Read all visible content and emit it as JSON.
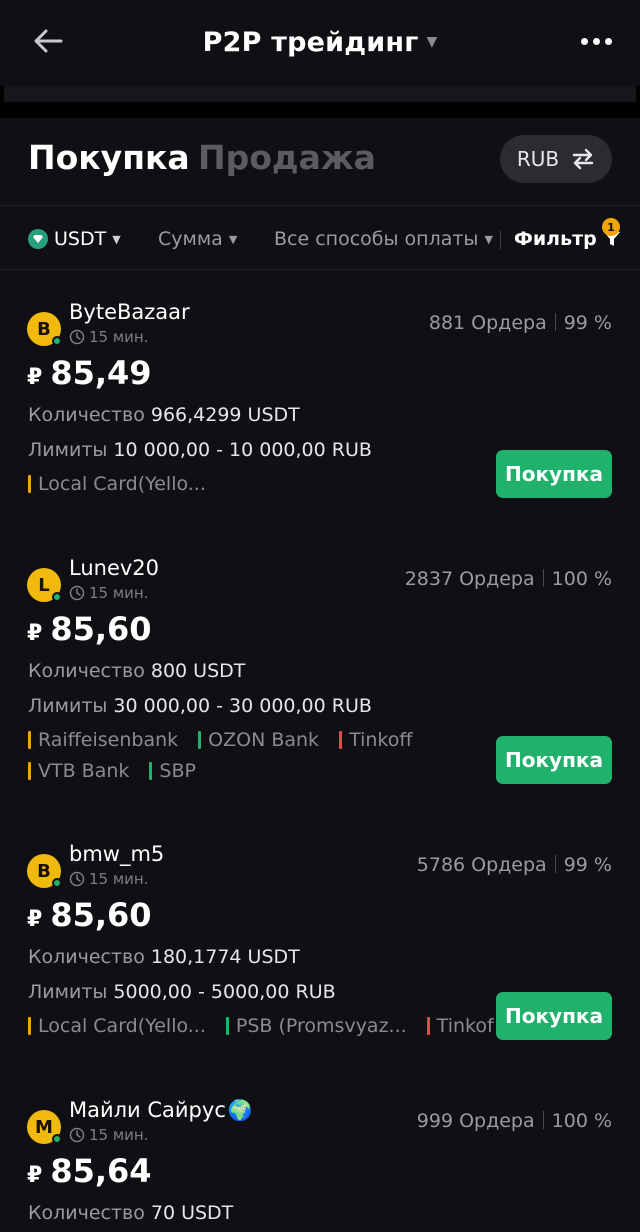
{
  "header": {
    "title": "P2P трейдинг",
    "back_icon": "arrow-left-icon",
    "more_icon": "more-dots-icon"
  },
  "tabs": {
    "buy": "Покупка",
    "sell": "Продажа",
    "currency": "RUB"
  },
  "filters": {
    "coin": "USDT",
    "amount": "Сумма",
    "payment": "Все способы оплаты",
    "filter": "Фильтр",
    "filter_count": "1"
  },
  "labels": {
    "quantity": "Количество",
    "limits": "Лимиты",
    "buy_button": "Покупка",
    "currency_symbol": "₽"
  },
  "colors": {
    "accent_green": "#20b26c",
    "avatar": "#f0b90b",
    "usdt": "#26a17b"
  },
  "offers": [
    {
      "avatar": "B",
      "name": "ByteBazaar",
      "emoji": "",
      "time": "15 мин.",
      "orders": "881 Ордера",
      "rate": "99 %",
      "price": "85,49",
      "quantity": "966,4299 USDT",
      "limits": "10 000,00 - 10 000,00 RUB",
      "payments": [
        [
          {
            "name": "Local Card(Yello...",
            "color": "#f0a500"
          }
        ]
      ]
    },
    {
      "avatar": "L",
      "name": "Lunev20",
      "emoji": "",
      "time": "15 мин.",
      "orders": "2837 Ордера",
      "rate": "100 %",
      "price": "85,60",
      "quantity": "800 USDT",
      "limits": "30 000,00 - 30 000,00 RUB",
      "payments": [
        [
          {
            "name": "Raiffeisenbank",
            "color": "#f0a500"
          },
          {
            "name": "OZON Bank",
            "color": "#20b26c"
          },
          {
            "name": "Tinkoff",
            "color": "#e5484d"
          }
        ],
        [
          {
            "name": "VTB Bank",
            "color": "#f0a500"
          },
          {
            "name": "SBP",
            "color": "#20b26c"
          }
        ]
      ]
    },
    {
      "avatar": "B",
      "name": "bmw_m5",
      "emoji": "",
      "time": "15 мин.",
      "orders": "5786 Ордера",
      "rate": "99 %",
      "price": "85,60",
      "quantity": "180,1774 USDT",
      "limits": "5000,00 - 5000,00 RUB",
      "payments": [
        [
          {
            "name": "Local Card(Yello...",
            "color": "#f0a500"
          },
          {
            "name": "PSB (Promsvyaz...",
            "color": "#20b26c"
          },
          {
            "name": "Tinkoff",
            "color": "#e5484d"
          }
        ]
      ]
    },
    {
      "avatar": "M",
      "name": "Майли Сайрус",
      "emoji": "🌍",
      "time": "15 мин.",
      "orders": "999 Ордера",
      "rate": "100 %",
      "price": "85,64",
      "quantity": "70 USDT",
      "limits": "",
      "payments": []
    }
  ]
}
